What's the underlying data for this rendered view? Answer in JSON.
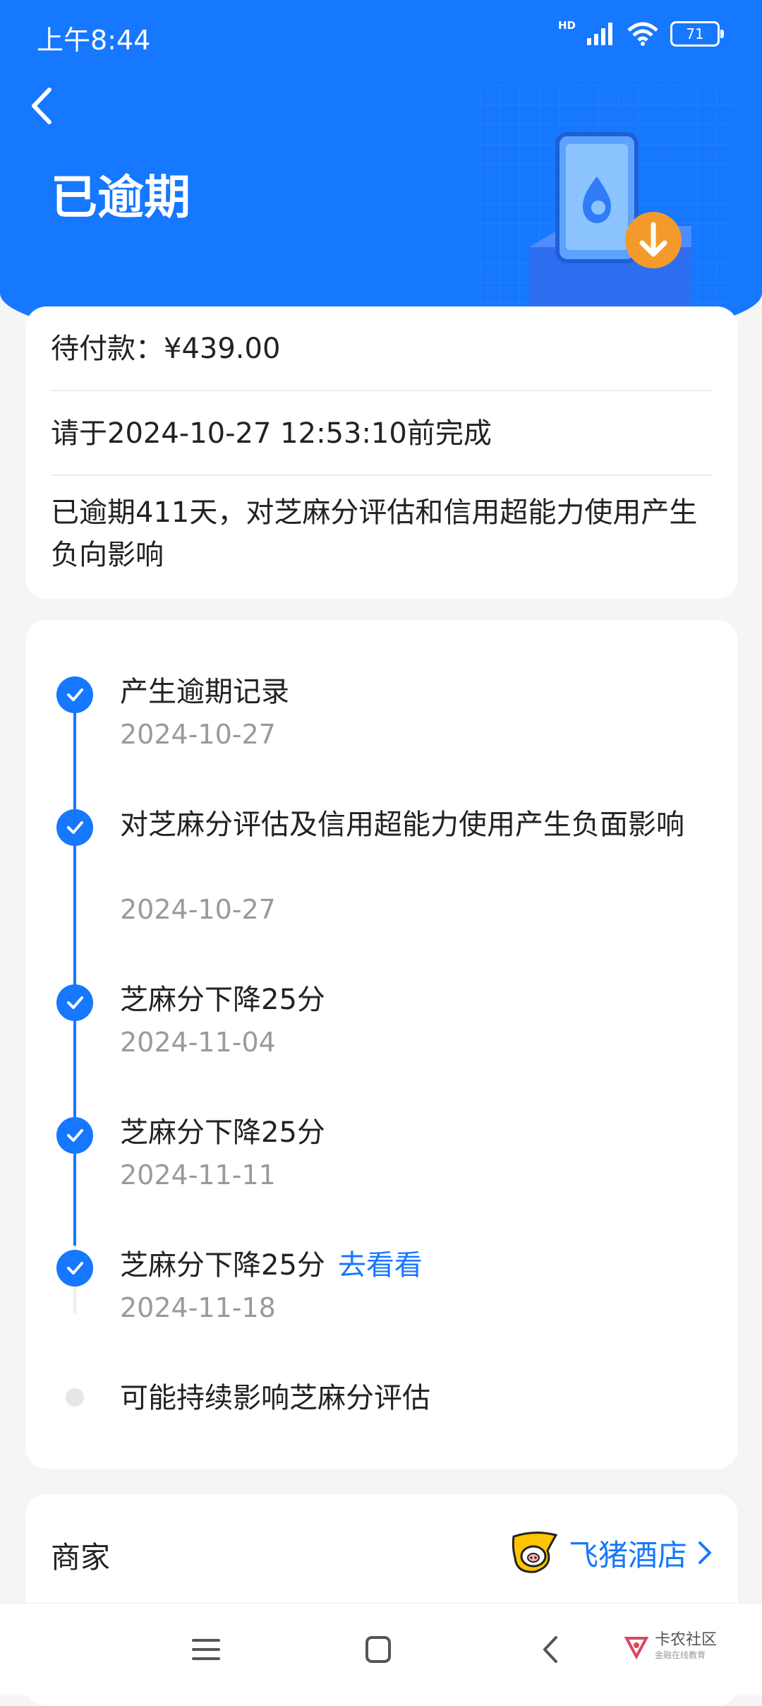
{
  "status_bar": {
    "time": "上午8:44",
    "network": "HD",
    "battery": "71"
  },
  "header": {
    "title": "已逾期"
  },
  "summary": {
    "amount_text": "待付款：¥439.00",
    "deadline_text": "请于2024-10-27 12:53:10前完成",
    "overdue_text": "已逾期411天，对芝麻分评估和信用超能力使用产生负向影响"
  },
  "timeline": {
    "items": [
      {
        "title": "产生逾期记录",
        "date": "2024-10-27"
      },
      {
        "title": "对芝麻分评估及信用超能力使用产生负面影响",
        "date": "2024-10-27"
      },
      {
        "title": "芝麻分下降25分",
        "date": "2024-11-04"
      },
      {
        "title": "芝麻分下降25分",
        "date": "2024-11-11"
      },
      {
        "title": "芝麻分下降25分",
        "date": "2024-11-18",
        "link": "去看看"
      },
      {
        "title": "可能持续影响芝麻分评估"
      }
    ]
  },
  "merchant": {
    "label": "商家",
    "name": "飞猪酒店"
  },
  "watermark": {
    "title": "卡农社区",
    "subtitle": "金融在线教育"
  },
  "colors": {
    "primary": "#1677ff",
    "accent_orange": "#f39a2b",
    "background": "#f5f5f5"
  }
}
